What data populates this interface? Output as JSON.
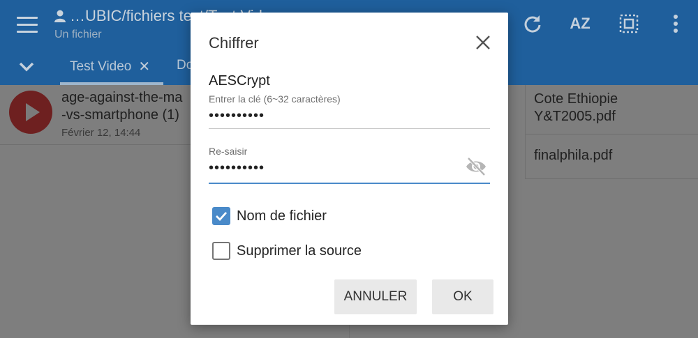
{
  "appbar": {
    "title": "…UBIC/fichiers test/Test Vid…",
    "subtitle": "Un fichier",
    "actions": [
      {
        "icon": "refresh-icon"
      },
      {
        "icon": "sort-az-icon",
        "label": "AZ"
      },
      {
        "icon": "select-all-icon"
      },
      {
        "icon": "more-vert-icon"
      }
    ]
  },
  "tabs": [
    {
      "label": "Test Video",
      "closable": true
    },
    {
      "label": "Do"
    }
  ],
  "files_left": [
    {
      "name_line1": "age-against-the-ma",
      "name_line2": "-vs-smartphone (1)",
      "date": "Février 12, 14:44",
      "icon": "play-icon"
    }
  ],
  "files_right": [
    {
      "name_line1": "Cote Ethiopie",
      "name_line2": "Y&T2005.pdf"
    },
    {
      "name_line1": "finalphila.pdf"
    }
  ],
  "dialog": {
    "title": "Chiffrer",
    "method": "AESCrypt",
    "key_label": "Entrer la clé (6~32 caractères)",
    "key_value": "••••••••••",
    "confirm_label": "Re-saisir",
    "confirm_value": "••••••••••",
    "options": [
      {
        "label": "Nom de fichier",
        "checked": true
      },
      {
        "label": "Supprimer la source",
        "checked": false
      }
    ],
    "cancel_label": "ANNULER",
    "ok_label": "OK"
  },
  "colors": {
    "appbar": "#1f5f9c",
    "accent": "#4a8ac9",
    "scrim": "#808080"
  }
}
